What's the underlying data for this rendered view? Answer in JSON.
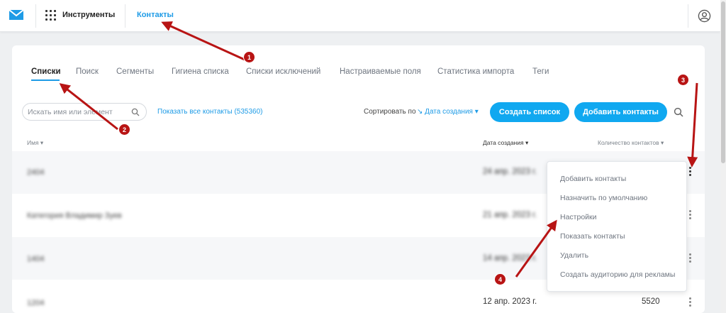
{
  "topbar": {
    "tools_label": "Инструменты",
    "contacts_label": "Контакты"
  },
  "tabs": [
    {
      "label": "Списки",
      "active": true
    },
    {
      "label": "Поиск"
    },
    {
      "label": "Сегменты"
    },
    {
      "label": "Гигиена списка"
    },
    {
      "label": "Списки исключений"
    },
    {
      "label": "Настраиваемые поля"
    },
    {
      "label": "Статистика импорта"
    },
    {
      "label": "Теги"
    }
  ],
  "toolbar": {
    "search_placeholder": "Искать имя или элемент",
    "show_all": "Показать все контакты (535360)",
    "sort_label": "Сортировать по",
    "sort_value": "Дата создания",
    "create_list": "Создать список",
    "add_contacts": "Добавить контакты"
  },
  "table": {
    "headers": {
      "name": "Имя",
      "date": "Дата создания",
      "count": "Количество контактов"
    },
    "rows": [
      {
        "name": "2404",
        "date": "24 апр. 2023 г.",
        "count": ""
      },
      {
        "name": "Категория Владимир Зуев",
        "date": "21 апр. 2023 г.",
        "count": ""
      },
      {
        "name": "1404",
        "date": "14 апр. 2023 г.",
        "count": ""
      },
      {
        "name": "1204",
        "date": "12 апр. 2023 г.",
        "count": "5520"
      }
    ]
  },
  "context_menu": {
    "items": [
      "Добавить контакты",
      "Назначить по умолчанию",
      "Настройки",
      "Показать контакты",
      "Удалить",
      "Создать аудиторию для рекламы"
    ]
  },
  "annotations": {
    "badges": [
      "1",
      "2",
      "3",
      "4"
    ],
    "color": "#b81414"
  },
  "colors": {
    "accent": "#1e9be6",
    "button": "#10a8f0"
  }
}
